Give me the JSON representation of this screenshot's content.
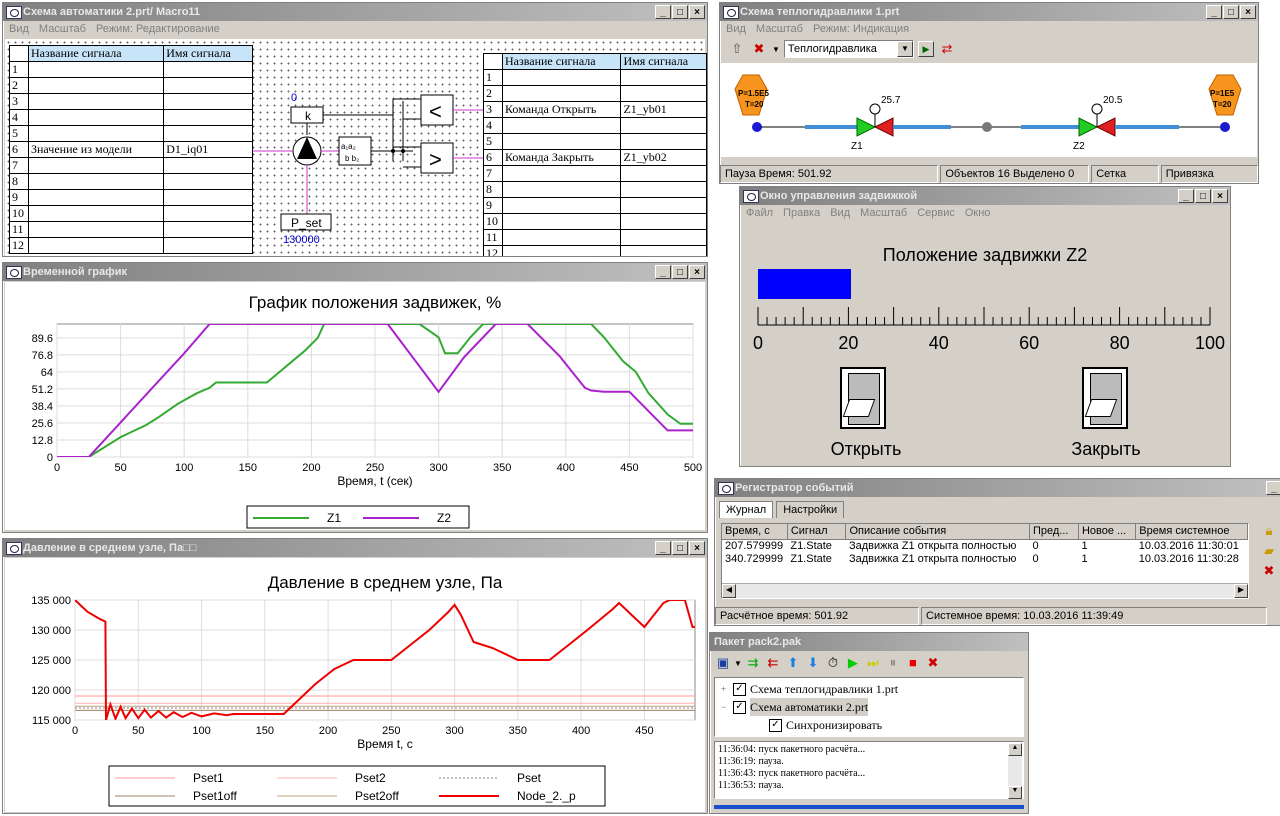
{
  "automation": {
    "title": "Схема автоматики 2.prt/ Macro11",
    "menu": [
      "Вид",
      "Масштаб",
      "Режим: Редактирование"
    ],
    "left_table": {
      "headers": [
        "Название сигнала",
        "Имя сигнала"
      ],
      "rows": [
        [
          "1",
          "",
          ""
        ],
        [
          "2",
          "",
          ""
        ],
        [
          "3",
          "",
          ""
        ],
        [
          "4",
          "",
          ""
        ],
        [
          "5",
          "",
          ""
        ],
        [
          "6",
          "Значение из модели",
          "D1_iq01"
        ],
        [
          "7",
          "",
          ""
        ],
        [
          "8",
          "",
          ""
        ],
        [
          "9",
          "",
          ""
        ],
        [
          "10",
          "",
          ""
        ],
        [
          "11",
          "",
          ""
        ],
        [
          "12",
          "",
          ""
        ]
      ]
    },
    "right_table": {
      "headers": [
        "Название сигнала",
        "Имя сигнала"
      ],
      "rows": [
        [
          "1",
          "",
          ""
        ],
        [
          "2",
          "",
          ""
        ],
        [
          "3",
          "Команда Открыть",
          "Z1_yb01"
        ],
        [
          "4",
          "",
          ""
        ],
        [
          "5",
          "",
          ""
        ],
        [
          "6",
          "Команда Закрыть",
          "Z1_yb02"
        ],
        [
          "7",
          "",
          ""
        ],
        [
          "8",
          "",
          ""
        ],
        [
          "9",
          "",
          ""
        ],
        [
          "10",
          "",
          ""
        ],
        [
          "11",
          "",
          ""
        ],
        [
          "12",
          "",
          ""
        ]
      ]
    },
    "blocks": {
      "k_value": "0",
      "k_label": "k",
      "lt": "<",
      "gt": ">",
      "pset_label": "P_set",
      "pset_value": "130000"
    }
  },
  "hydraulics": {
    "title": "Схема теплогидравлики 1.prt",
    "menu": [
      "Вид",
      "Масштаб",
      "Режим: Индикация"
    ],
    "combo_value": "Теплогидравлика",
    "node_left": {
      "p": "P=1.5E5",
      "t": "T=20"
    },
    "node_right": {
      "p": "P=1E5",
      "t": "T=20"
    },
    "valve1": {
      "label": "Z1",
      "value": "25.7"
    },
    "valve2": {
      "label": "Z2",
      "value": "20.5"
    },
    "status": [
      "Пауза  Время: 501.92",
      "Объектов 16  Выделено 0",
      "Сетка",
      "Привязка"
    ]
  },
  "valve_control": {
    "title": "Окно управления задвижкой",
    "menu": [
      "Файл",
      "Правка",
      "Вид",
      "Масштаб",
      "Сервис",
      "Окно"
    ],
    "heading": "Положение задвижки Z2",
    "position_fraction": 0.205,
    "scale_labels": [
      "0",
      "20",
      "40",
      "60",
      "80",
      "100"
    ],
    "open_label": "Открыть",
    "close_label": "Закрыть",
    "bar_color": "#0000ff"
  },
  "time_chart": {
    "window_title": "Временной график",
    "chart_data": {
      "type": "line",
      "title": "График положения задвижек, %",
      "xlabel": "Время, t (сек)",
      "ylabel": "",
      "xlim": [
        0,
        500
      ],
      "ylim": [
        0,
        100
      ],
      "xticks": [
        "0",
        "50",
        "100",
        "150",
        "200",
        "250",
        "300",
        "350",
        "400",
        "450",
        "500"
      ],
      "yticks": [
        "0",
        "12.8",
        "25.6",
        "38.4",
        "51.2",
        "64",
        "76.8",
        "89.6"
      ],
      "legend": "bottom",
      "grid": true,
      "series": [
        {
          "name": "Z1",
          "color": "#33aa33",
          "points": [
            [
              0,
              0
            ],
            [
              25,
              0
            ],
            [
              50,
              15
            ],
            [
              70,
              24
            ],
            [
              80,
              30
            ],
            [
              95,
              40
            ],
            [
              110,
              48
            ],
            [
              120,
              52
            ],
            [
              125,
              56
            ],
            [
              150,
              56
            ],
            [
              165,
              56
            ],
            [
              175,
              64
            ],
            [
              185,
              72
            ],
            [
              195,
              80
            ],
            [
              205,
              89.6
            ],
            [
              210,
              100
            ],
            [
              250,
              100
            ],
            [
              260,
              100
            ],
            [
              285,
              100
            ],
            [
              300,
              90
            ],
            [
              305,
              78
            ],
            [
              315,
              78
            ],
            [
              325,
              90
            ],
            [
              335,
              100
            ],
            [
              400,
              100
            ],
            [
              420,
              100
            ],
            [
              430,
              90
            ],
            [
              440,
              78
            ],
            [
              445,
              72
            ],
            [
              455,
              64
            ],
            [
              465,
              48
            ],
            [
              480,
              32
            ],
            [
              490,
              25
            ],
            [
              500,
              25
            ]
          ]
        },
        {
          "name": "Z2",
          "color": "#aa22cc",
          "points": [
            [
              0,
              0
            ],
            [
              25,
              0
            ],
            [
              50,
              26
            ],
            [
              75,
              52
            ],
            [
              100,
              78
            ],
            [
              120,
              100
            ],
            [
              160,
              100
            ],
            [
              205,
              100
            ],
            [
              250,
              100
            ],
            [
              260,
              100
            ],
            [
              300,
              49
            ],
            [
              320,
              75
            ],
            [
              345,
              100
            ],
            [
              370,
              100
            ],
            [
              395,
              76
            ],
            [
              415,
              52
            ],
            [
              420,
              50
            ],
            [
              430,
              49
            ],
            [
              450,
              49
            ],
            [
              480,
              20
            ],
            [
              500,
              20
            ]
          ]
        }
      ]
    }
  },
  "pressure_chart": {
    "window_title": "Давление в среднем узле, Па□□",
    "chart_data": {
      "type": "line",
      "title": "Давление в среднем узле, Па",
      "xlabel": "Время t, с",
      "ylabel": "",
      "xlim": [
        0,
        490
      ],
      "ylim": [
        115000,
        135000
      ],
      "xticks": [
        "0",
        "50",
        "100",
        "150",
        "200",
        "250",
        "300",
        "350",
        "400",
        "450"
      ],
      "yticks": [
        "115 000",
        "120 000",
        "125 000",
        "130 000",
        "135 000"
      ],
      "legend": "bottom",
      "grid": true,
      "series": [
        {
          "name": "Pset1",
          "color": "#ff9999",
          "style": "solid",
          "points": [
            [
              0,
              119000
            ],
            [
              490,
              119000
            ]
          ]
        },
        {
          "name": "Pset2",
          "color": "#ffb0b0",
          "style": "solid",
          "points": [
            [
              0,
              117800
            ],
            [
              490,
              117800
            ]
          ]
        },
        {
          "name": "Pset",
          "color": "#808080",
          "style": "dotted",
          "points": [
            [
              0,
              117000
            ],
            [
              490,
              117000
            ]
          ]
        },
        {
          "name": "Pset1off",
          "color": "#a08060",
          "style": "solid",
          "points": [
            [
              0,
              116600
            ],
            [
              490,
              116600
            ]
          ]
        },
        {
          "name": "Pset2off",
          "color": "#c0a080",
          "style": "solid",
          "points": [
            [
              0,
              117300
            ],
            [
              490,
              117300
            ]
          ]
        },
        {
          "name": "Node_2._p",
          "color": "#ee0000",
          "style": "solid",
          "points": [
            [
              0,
              135000
            ],
            [
              5,
              134000
            ],
            [
              10,
              133000
            ],
            [
              20,
              131800
            ],
            [
              24,
              131400
            ],
            [
              24.5,
              115000
            ],
            [
              28,
              117600
            ],
            [
              32,
              115200
            ],
            [
              36,
              117200
            ],
            [
              40,
              115300
            ],
            [
              45,
              116900
            ],
            [
              50,
              115300
            ],
            [
              55,
              116700
            ],
            [
              60,
              115400
            ],
            [
              66,
              116500
            ],
            [
              72,
              115400
            ],
            [
              78,
              116300
            ],
            [
              85,
              115500
            ],
            [
              92,
              116200
            ],
            [
              100,
              115600
            ],
            [
              110,
              116100
            ],
            [
              120,
              115800
            ],
            [
              125,
              116000
            ],
            [
              165,
              116000
            ],
            [
              175,
              118000
            ],
            [
              190,
              121000
            ],
            [
              205,
              123500
            ],
            [
              220,
              125000
            ],
            [
              250,
              125000
            ],
            [
              265,
              127500
            ],
            [
              280,
              130000
            ],
            [
              295,
              133000
            ],
            [
              300,
              134200
            ],
            [
              305,
              132500
            ],
            [
              315,
              128000
            ],
            [
              330,
              127000
            ],
            [
              350,
              125000
            ],
            [
              375,
              125000
            ],
            [
              390,
              127500
            ],
            [
              405,
              130000
            ],
            [
              425,
              133500
            ],
            [
              430,
              134500
            ],
            [
              440,
              132500
            ],
            [
              450,
              130500
            ],
            [
              465,
              134500
            ],
            [
              470,
              135000
            ],
            [
              482,
              135000
            ],
            [
              488,
              130500
            ],
            [
              490,
              130500
            ]
          ]
        }
      ]
    }
  },
  "events": {
    "title": "Регистратор событий",
    "tabs": [
      "Журнал",
      "Настройки"
    ],
    "headers": [
      "Время, с",
      "Сигнал",
      "Описание события",
      "Пред...",
      "Новое ...",
      "Время системное"
    ],
    "rows": [
      [
        "207.579999",
        "Z1.State",
        "Задвижка Z1 открыта полностью",
        "0",
        "1",
        "10.03.2016 11:30:01"
      ],
      [
        "340.729999",
        "Z1.State",
        "Задвижка Z1 открыта полностью",
        "0",
        "1",
        "10.03.2016 11:30:28"
      ]
    ],
    "status": [
      "Расчётное время: 501.92",
      "Системное время: 10.03.2016 11:39:49"
    ]
  },
  "packet": {
    "title": "Пакет  pack2.pak",
    "tree": [
      {
        "label": "Схема теплогидравлики 1.prt",
        "level": 0,
        "checked": true
      },
      {
        "label": "Схема автоматики 2.prt",
        "level": 0,
        "checked": true,
        "selected": true
      },
      {
        "label": "Синхронизировать",
        "level": 1,
        "checked": true
      }
    ],
    "log": [
      "11:36:04: пуск пакетного расчёта...",
      "11:36:19: пауза.",
      "11:36:43: пуск пакетного расчёта...",
      "11:36:53: пауза."
    ]
  }
}
